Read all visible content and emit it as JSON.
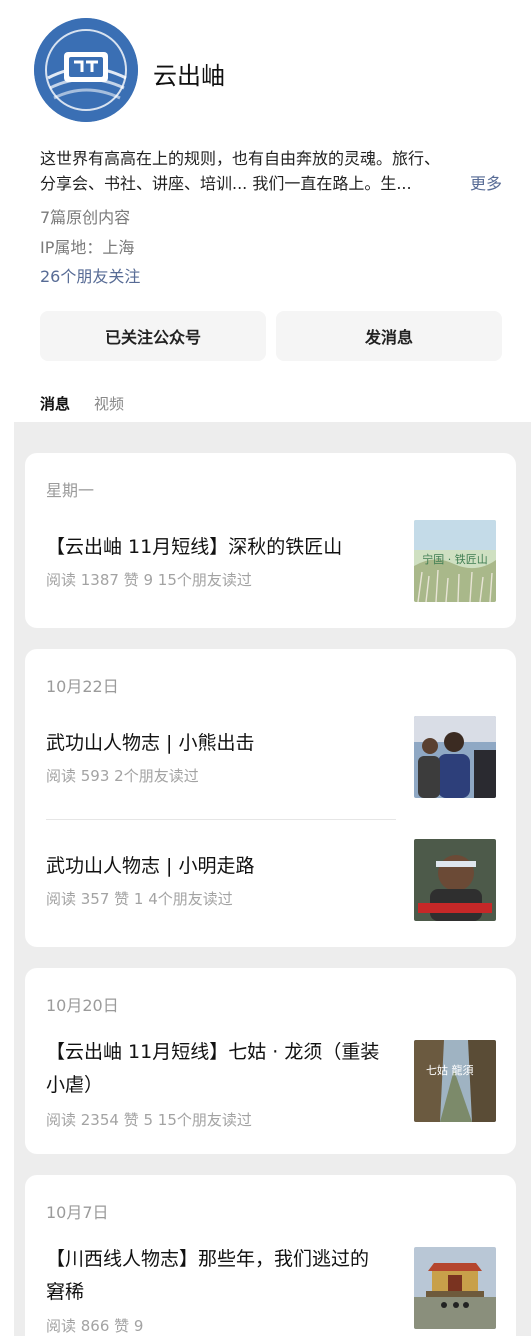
{
  "account": {
    "name": "云出岫",
    "bio_line1": "这世界有高高在上的规则，也有自由奔放的灵魂。旅行、",
    "bio_line2": "分享会、书社、讲座、培训... 我们一直在路上。生...",
    "more_label": "更多",
    "original_count": "7篇原创内容",
    "ip_location": "IP属地：上海",
    "friends_following": "26个朋友关注"
  },
  "actions": {
    "follow_label": "已关注公众号",
    "message_label": "发消息"
  },
  "tabs": [
    {
      "label": "消息",
      "active": true
    },
    {
      "label": "视频",
      "active": false
    }
  ],
  "groups": [
    {
      "date": "星期一",
      "articles": [
        {
          "title": "【云出岫 11月短线】深秋的铁匠山",
          "stats": "阅读 1387  赞 9  15个朋友读过",
          "thumb_text": "宁国 · 铁匠山"
        }
      ]
    },
    {
      "date": "10月22日",
      "articles": [
        {
          "title": "武功山人物志 | 小熊出击",
          "stats": "阅读 593  2个朋友读过"
        },
        {
          "title": "武功山人物志 | 小明走路",
          "stats": "阅读 357  赞 1  4个朋友读过"
        }
      ]
    },
    {
      "date": "10月20日",
      "articles": [
        {
          "title_line1": "【云出岫 11月短线】七姑 · 龙须（重装",
          "title_line2": "小虐）",
          "stats": "阅读 2354  赞 5  15个朋友读过",
          "thumb_text": "七姑 龍須"
        }
      ]
    },
    {
      "date": "10月7日",
      "articles": [
        {
          "title_line1": "【川西线人物志】那些年，我们逃过的",
          "title_line2": "窘稀",
          "stats": "阅读 866  赞 9"
        }
      ]
    }
  ]
}
